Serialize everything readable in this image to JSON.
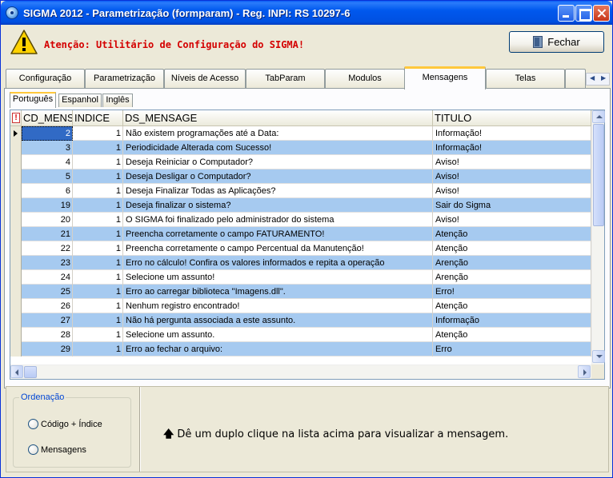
{
  "window": {
    "title": "SIGMA 2012 - Parametrização  (formparam)  - Reg. INPI: RS 10297-6"
  },
  "header": {
    "warning": "Atenção: Utilitário de Configuração do SIGMA!",
    "close_button": "Fechar"
  },
  "tabs": [
    {
      "label": "Configuração"
    },
    {
      "label": "Parametrização"
    },
    {
      "label": "Níveis de Acesso"
    },
    {
      "label": "TabParam"
    },
    {
      "label": "Modulos"
    },
    {
      "label": "Mensagens"
    },
    {
      "label": "Telas"
    }
  ],
  "active_tab": "Mensagens",
  "sub_tabs": [
    {
      "label": "Português"
    },
    {
      "label": "Espanhol"
    },
    {
      "label": "Inglês"
    }
  ],
  "active_sub_tab": "Português",
  "grid": {
    "columns": [
      "CD_MENSAGEM",
      "INDICE",
      "DS_MENSAGE",
      "TITULO"
    ],
    "rows": [
      {
        "cd": "2",
        "indice": "1",
        "ds": "Não existem programações até a Data:",
        "titulo": "Informação!"
      },
      {
        "cd": "3",
        "indice": "1",
        "ds": "Periodicidade Alterada com Sucesso!",
        "titulo": "Informação!"
      },
      {
        "cd": "4",
        "indice": "1",
        "ds": "Deseja Reiniciar o Computador?",
        "titulo": "Aviso!"
      },
      {
        "cd": "5",
        "indice": "1",
        "ds": "Deseja Desligar o Computador?",
        "titulo": "Aviso!"
      },
      {
        "cd": "6",
        "indice": "1",
        "ds": "Deseja Finalizar Todas as Aplicações?",
        "titulo": "Aviso!"
      },
      {
        "cd": "19",
        "indice": "1",
        "ds": "Deseja finalizar o sistema?",
        "titulo": "Sair do Sigma"
      },
      {
        "cd": "20",
        "indice": "1",
        "ds": "O SIGMA foi finalizado pelo administrador do sistema",
        "titulo": "Aviso!"
      },
      {
        "cd": "21",
        "indice": "1",
        "ds": "Preencha corretamente o campo FATURAMENTO!",
        "titulo": "Atenção"
      },
      {
        "cd": "22",
        "indice": "1",
        "ds": "Preencha corretamente o campo Percentual da Manutenção!",
        "titulo": "Atenção"
      },
      {
        "cd": "23",
        "indice": "1",
        "ds": "Erro no cálculo! Confira os valores informados e repita a operação",
        "titulo": "Arenção"
      },
      {
        "cd": "24",
        "indice": "1",
        "ds": "Selecione um assunto!",
        "titulo": "Arenção"
      },
      {
        "cd": "25",
        "indice": "1",
        "ds": "Erro ao carregar biblioteca \"Imagens.dll\".",
        "titulo": "Erro!"
      },
      {
        "cd": "26",
        "indice": "1",
        "ds": "Nenhum registro encontrado!",
        "titulo": "Atenção"
      },
      {
        "cd": "27",
        "indice": "1",
        "ds": "Não há pergunta associada a este assunto.",
        "titulo": "Informação"
      },
      {
        "cd": "28",
        "indice": "1",
        "ds": "Selecione um assunto.",
        "titulo": "Atenção"
      },
      {
        "cd": "29",
        "indice": "1",
        "ds": "Erro ao fechar o arquivo:",
        "titulo": "Erro"
      }
    ]
  },
  "ordering": {
    "title": "Ordenação",
    "options": [
      "Código + Índice",
      "Mensagens"
    ]
  },
  "hint": "Dê um duplo clique na lista acima para visualizar a mensagem.",
  "colors": {
    "title_bar": "#0058ee",
    "alt_row": "#a6caf0",
    "warning_text": "#d40000",
    "active_tab_accent": "#ffc83c"
  }
}
